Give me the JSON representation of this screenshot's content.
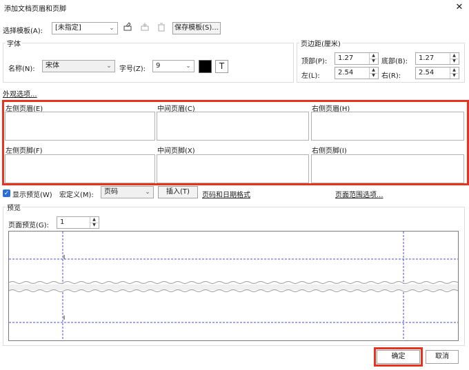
{
  "window": {
    "title": "添加文档页眉和页脚",
    "close": "✕"
  },
  "template": {
    "label": "选择模板(A):",
    "value": "[未指定]",
    "save_label": "保存模板(S)..."
  },
  "font": {
    "group": "字体",
    "name_label": "名称(N):",
    "name_value": "宋体",
    "size_label": "字号(Z):",
    "size_value": "9",
    "color": "#000000",
    "text_icon": "T"
  },
  "margins": {
    "group": "页边距(厘米)",
    "top_label": "顶部(P):",
    "top_value": "1.27",
    "bottom_label": "底部(B):",
    "bottom_value": "1.27",
    "left_label": "左(L):",
    "left_value": "2.54",
    "right_label": "右(R):",
    "right_value": "2.54"
  },
  "appearance_link": "外观选项...",
  "header": {
    "left_label": "左侧页眉(E)",
    "center_label": "中间页眉(C)",
    "right_label": "右侧页眉(H)"
  },
  "footer": {
    "left_label": "左侧页脚(F)",
    "center_label": "中间页脚(X)",
    "right_label": "右侧页脚(I)"
  },
  "options": {
    "show_preview": "显示预览(W)",
    "macro_label": "宏定义(M):",
    "macro_value": "页码",
    "insert": "插入(T)",
    "page_number_format": "页码和日期格式",
    "page_range": "页面范围选项..."
  },
  "preview": {
    "group": "预览",
    "page_label": "页面预览(G):",
    "page_value": "1"
  },
  "footer_buttons": {
    "ok": "确定",
    "cancel": "取消"
  }
}
